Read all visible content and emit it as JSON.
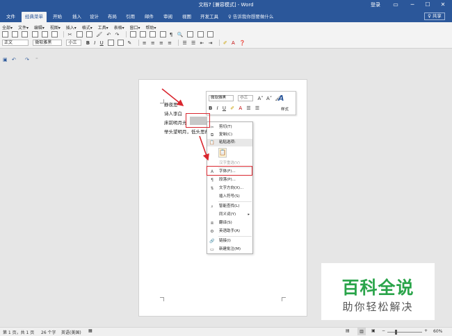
{
  "window": {
    "title": "文档7 [兼容模式] - Word",
    "login": "登录",
    "controls": [
      "ribbon-options",
      "minimize",
      "maximize",
      "close"
    ]
  },
  "ribbon_tabs": [
    "文件",
    "经典菜单",
    "开始",
    "插入",
    "设计",
    "布局",
    "引用",
    "邮件",
    "审阅",
    "视图",
    "开发工具"
  ],
  "active_tab": "经典菜单",
  "tell_me": "♀ 告诉我你想要做什么",
  "share": "♀ 共享",
  "classic_menu": [
    "全部▾",
    "文件▾",
    "编辑▾",
    "视图▾",
    "插入▾",
    "格式▾",
    "工具▾",
    "表格▾",
    "窗口▾",
    "帮助▾"
  ],
  "toolbar": {
    "style": "正文",
    "font": "微软雅黑",
    "size": "小三",
    "bold": "B",
    "italic": "I",
    "underline": "U"
  },
  "document": {
    "lines": [
      "静夜思",
      "诗人李白",
      "床前明月光",
      "举头望明月，低头思故"
    ]
  },
  "mini_toolbar": {
    "font": "微软雅黑",
    "size": "小三",
    "styles_label": "样式"
  },
  "context_menu": {
    "cut": "剪切(T)",
    "copy": "复制(C)",
    "paste_options": "粘贴选项:",
    "chinese_convert": "汉字重选(V)",
    "font": "字体(F)...",
    "paragraph": "段落(P)...",
    "text_direction": "文字方向(X)...",
    "insert_symbol": "插入符号(S)",
    "smart_lookup": "智能查找(L)",
    "synonyms": "同义词(Y)",
    "translate": "翻译(S)",
    "english_assistant": "英语助手(A)",
    "link": "链接(I)",
    "new_comment": "新建批注(M)"
  },
  "status_bar": {
    "page": "第 1 页，共 1 页",
    "words": "26 个字",
    "language": "英语(美国)",
    "zoom": "60%"
  },
  "watermark": {
    "big": "百科全说",
    "small": "助你轻松解决"
  },
  "colors": {
    "brand": "#2b579a",
    "annotation": "#d9262e",
    "watermark_green": "#2aa44a"
  }
}
